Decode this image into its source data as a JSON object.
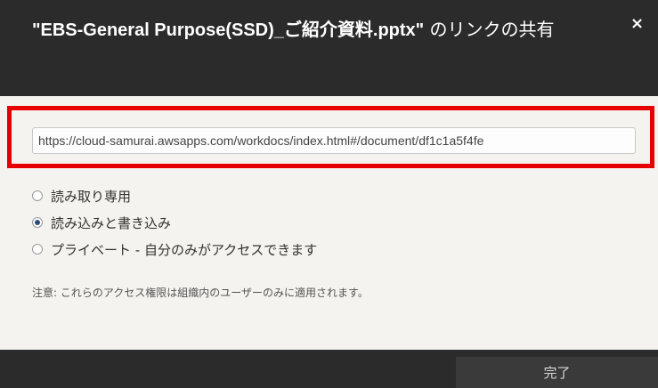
{
  "dialog": {
    "title_filename": "\"EBS-General Purpose(SSD)_ご紹介資料.pptx\"",
    "title_suffix": " のリンクの共有",
    "close_symbol": "×"
  },
  "link": {
    "url": "https://cloud-samurai.awsapps.com/workdocs/index.html#/document/df1c1a5f4fe"
  },
  "permissions": {
    "selected": "read_write",
    "options": [
      {
        "id": "read_only",
        "label": "読み取り専用"
      },
      {
        "id": "read_write",
        "label": "読み込みと書き込み"
      },
      {
        "id": "private",
        "label": "プライベート - 自分のみがアクセスできます"
      }
    ]
  },
  "note": "注意: これらのアクセス権限は組織内のユーザーのみに適用されます。",
  "footer": {
    "done_label": "完了"
  },
  "colors": {
    "header_bg": "#2b2b2b",
    "highlight": "#e60000",
    "body_bg": "#f5f3ef"
  }
}
